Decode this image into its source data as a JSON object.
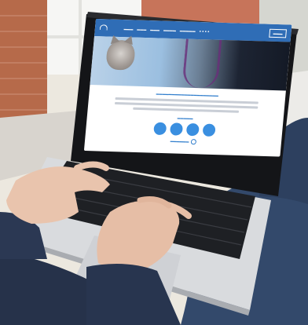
{
  "scene": {
    "description_colors": {
      "laptop_body": "#d9dbde",
      "keyboard": "#1e2024",
      "screen_bezel": "#141518",
      "brand_blue": "#2f6db6",
      "sweater": "#26324a",
      "jeans": "#32486a",
      "skin": "#e9c4ad"
    }
  },
  "website": {
    "brand_blue": "#2f6db6",
    "accent_blue": "#3a8fe0"
  }
}
